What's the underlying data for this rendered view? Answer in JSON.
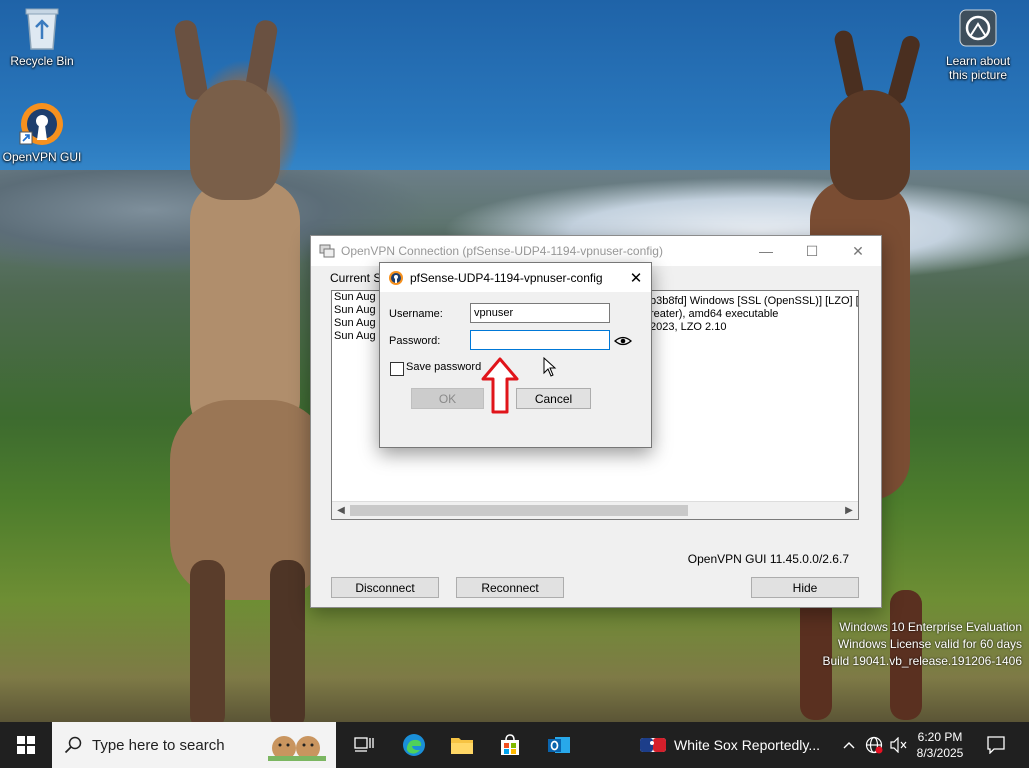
{
  "desktop": {
    "icons": [
      {
        "label": "Recycle Bin",
        "icon": "recycle-bin-icon"
      },
      {
        "label": "OpenVPN GUI",
        "icon": "openvpn-icon"
      },
      {
        "label": "Learn about this picture",
        "icon": "camera-icon"
      }
    ],
    "watermark": {
      "line1": "Windows 10 Enterprise Evaluation",
      "line2": "Windows License valid for 60 days",
      "line3": "Build 19041.vb_release.191206-1406"
    }
  },
  "vpn_window": {
    "title": "OpenVPN Connection (pfSense-UDP4-1194-vpnuser-config)",
    "status_label": "Current Sta",
    "log_left": [
      "Sun Aug",
      "Sun Aug",
      "Sun Aug",
      "Sun Aug"
    ],
    "log_right": [
      "b3b8fd] Windows [SSL (OpenSSL)] [LZO] [L",
      "reater), amd64 executable",
      "2023, LZO 2.10"
    ],
    "version": "OpenVPN GUI 11.45.0.0/2.6.7",
    "buttons": {
      "disconnect": "Disconnect",
      "reconnect": "Reconnect",
      "hide": "Hide"
    }
  },
  "login_dialog": {
    "title": "pfSense-UDP4-1194-vpnuser-config",
    "username_label": "Username:",
    "username_value": "vpnuser",
    "password_label": "Password:",
    "password_value": "",
    "save_password_label": "Save password",
    "save_password_checked": false,
    "ok_label": "OK",
    "cancel_label": "Cancel"
  },
  "taskbar": {
    "search_placeholder": "Type here to search",
    "news_text": "White Sox Reportedly...",
    "time": "6:20 PM",
    "date": "8/3/2025",
    "accent": "#0078d7"
  }
}
